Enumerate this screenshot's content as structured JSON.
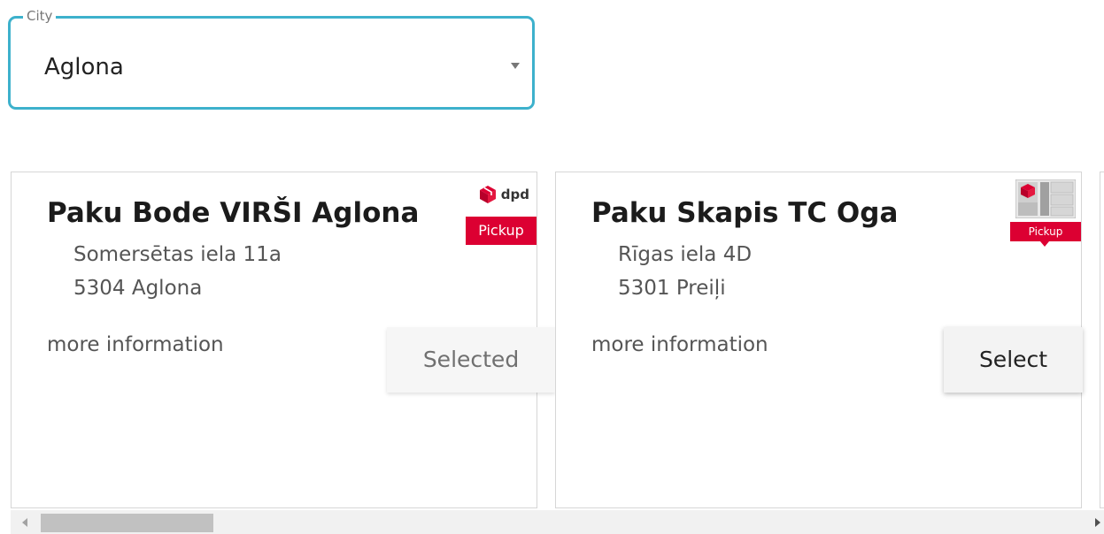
{
  "city_select": {
    "label": "City",
    "value": "Aglona",
    "accent_color": "#3db1cc"
  },
  "pickup_points": [
    {
      "title": "Paku Bode VIRŠI Aglona",
      "address_line1": "Somersētas iela 11a",
      "address_line2": "5304 Aglona",
      "more_info": "more information",
      "button_label": "Selected",
      "selected": true,
      "logo": {
        "type": "dpd-pickup-icon",
        "brand_text": "dpd",
        "tag_text": "Pickup"
      }
    },
    {
      "title": "Paku Skapis TC Oga",
      "address_line1": "Rīgas iela 4D",
      "address_line2": "5301 Preiļi",
      "more_info": "more information",
      "button_label": "Select",
      "selected": false,
      "logo": {
        "type": "parcel-locker-icon",
        "tag_text": "Pickup"
      }
    }
  ],
  "brand_color": "#dc0032",
  "scrollbar": {
    "position_fraction": 0.0
  }
}
